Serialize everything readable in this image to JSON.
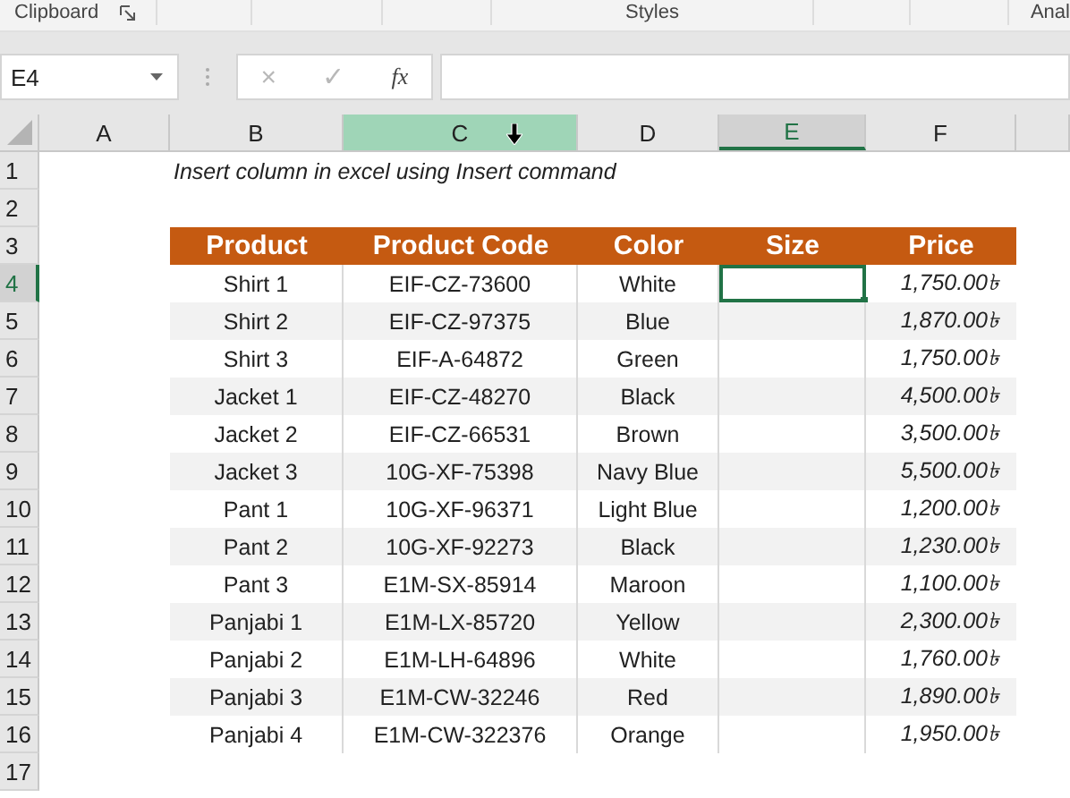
{
  "ribbon": {
    "groups": [
      {
        "label": "Clipboard",
        "launcher": true
      },
      {
        "label": "Styles"
      },
      {
        "label": "Anal"
      }
    ]
  },
  "name_box": {
    "value": "E4"
  },
  "formula_bar": {
    "cancel": "×",
    "enter": "✓",
    "function": "fx"
  },
  "columns": [
    {
      "label": "A",
      "highlighted": false,
      "selected": false
    },
    {
      "label": "B",
      "highlighted": false,
      "selected": false
    },
    {
      "label": "C",
      "highlighted": true,
      "selected": false
    },
    {
      "label": "D",
      "highlighted": false,
      "selected": false
    },
    {
      "label": "E",
      "highlighted": false,
      "selected": true
    },
    {
      "label": "F",
      "highlighted": false,
      "selected": false
    }
  ],
  "row_numbers": [
    {
      "label": "1",
      "selected": false
    },
    {
      "label": "2",
      "selected": false
    },
    {
      "label": "3",
      "selected": false
    },
    {
      "label": "4",
      "selected": true
    },
    {
      "label": "5",
      "selected": false
    },
    {
      "label": "6",
      "selected": false
    },
    {
      "label": "7",
      "selected": false
    },
    {
      "label": "8",
      "selected": false
    },
    {
      "label": "9",
      "selected": false
    },
    {
      "label": "10",
      "selected": false
    },
    {
      "label": "11",
      "selected": false
    },
    {
      "label": "12",
      "selected": false
    },
    {
      "label": "13",
      "selected": false
    },
    {
      "label": "14",
      "selected": false
    },
    {
      "label": "15",
      "selected": false
    },
    {
      "label": "16",
      "selected": false
    },
    {
      "label": "17",
      "selected": false
    }
  ],
  "title": "Insert column in excel using Insert command",
  "table": {
    "columns": [
      "Product",
      "Product Code",
      "Color",
      "Size",
      "Price"
    ],
    "rows": [
      {
        "product": "Shirt 1",
        "code": "EIF-CZ-73600",
        "color_name": "White",
        "size_selected": true,
        "price": "1,750.00৳"
      },
      {
        "product": "Shirt 2",
        "code": "EIF-CZ-97375",
        "color_name": "Blue",
        "size_selected": false,
        "price": "1,870.00৳"
      },
      {
        "product": "Shirt 3",
        "code": "EIF-A-64872",
        "color_name": "Green",
        "size_selected": false,
        "price": "1,750.00৳"
      },
      {
        "product": "Jacket 1",
        "code": "EIF-CZ-48270",
        "color_name": "Black",
        "size_selected": false,
        "price": "4,500.00৳"
      },
      {
        "product": "Jacket 2",
        "code": "EIF-CZ-66531",
        "color_name": "Brown",
        "size_selected": false,
        "price": "3,500.00৳"
      },
      {
        "product": "Jacket 3",
        "code": "10G-XF-75398",
        "color_name": "Navy Blue",
        "size_selected": false,
        "price": "5,500.00৳"
      },
      {
        "product": "Pant 1",
        "code": "10G-XF-96371",
        "color_name": "Light Blue",
        "size_selected": false,
        "price": "1,200.00৳"
      },
      {
        "product": "Pant 2",
        "code": "10G-XF-92273",
        "color_name": "Black",
        "size_selected": false,
        "price": "1,230.00৳"
      },
      {
        "product": "Pant 3",
        "code": "E1M-SX-85914",
        "color_name": "Maroon",
        "size_selected": false,
        "price": "1,100.00৳"
      },
      {
        "product": "Panjabi 1",
        "code": "E1M-LX-85720",
        "color_name": "Yellow",
        "size_selected": false,
        "price": "2,300.00৳"
      },
      {
        "product": "Panjabi 2",
        "code": "E1M-LH-64896",
        "color_name": "White",
        "size_selected": false,
        "price": "1,760.00৳"
      },
      {
        "product": "Panjabi 3",
        "code": "E1M-CW-32246",
        "color_name": "Red",
        "size_selected": false,
        "price": "1,890.00৳"
      },
      {
        "product": "Panjabi 4",
        "code": "E1M-CW-322376",
        "color_name": "Orange",
        "size_selected": false,
        "price": "1,950.00৳"
      }
    ]
  }
}
